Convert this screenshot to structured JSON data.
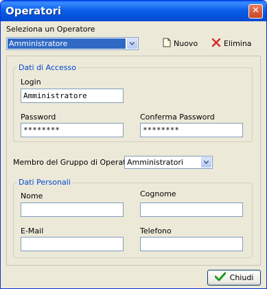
{
  "window": {
    "title": "Operatori"
  },
  "select_operator": {
    "label": "Seleziona un Operatore",
    "value": "Amministratore"
  },
  "toolbar": {
    "new_label": "Nuovo",
    "delete_label": "Elimina"
  },
  "access": {
    "legend": "Dati di Accesso",
    "login_label": "Login",
    "login_value": "Amministratore",
    "password_label": "Password",
    "password_value": "********",
    "confirm_label": "Conferma Password",
    "confirm_value": "********"
  },
  "group": {
    "label": "Membro del Gruppo di Operatori",
    "value": "Amministratori"
  },
  "personal": {
    "legend": "Dati Personali",
    "name_label": "Nome",
    "surname_label": "Cognome",
    "email_label": "E-Mail",
    "phone_label": "Telefono"
  },
  "footer": {
    "close_label": "Chiudi"
  },
  "colors": {
    "title_bar": "#0a5ff6",
    "legend_text": "#0046d5",
    "delete_icon": "#d8262a",
    "check_icon": "#1f9a1f"
  },
  "icons": {
    "new": "document-icon",
    "delete": "x-icon",
    "close_window": "close-icon",
    "ok": "checkmark-icon"
  }
}
